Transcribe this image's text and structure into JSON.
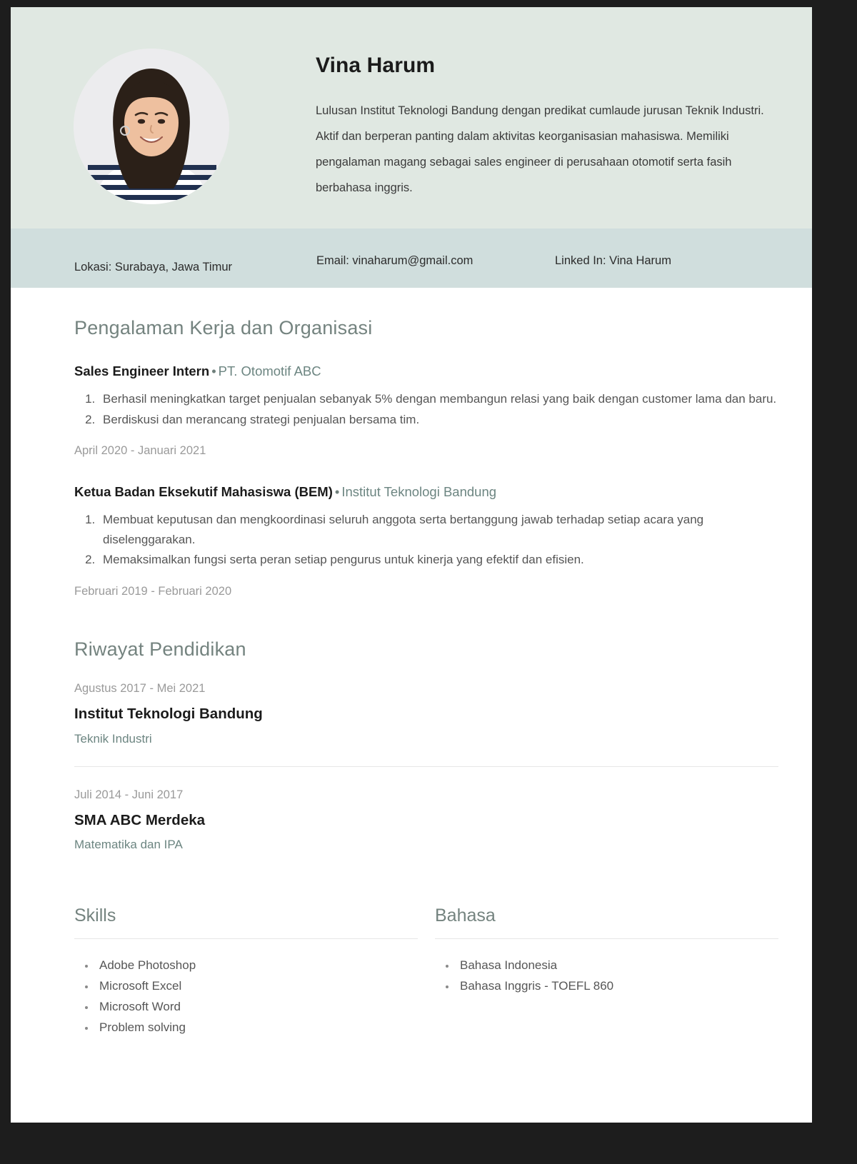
{
  "theme": {
    "header_bg": "#e0e8e2",
    "contact_bg": "#d0dedd",
    "page_bg": "#ffffff",
    "frame_bg": "#1d1d1d",
    "accent_heading": "#74837f",
    "accent_org": "#6c8581",
    "muted_text": "#9a9a9a",
    "body_text": "#565656"
  },
  "header": {
    "name": "Vina Harum",
    "summary": "Lulusan Institut Teknologi Bandung dengan predikat cumlaude jurusan Teknik Industri. Aktif dan berperan panting dalam aktivitas keorganisasian mahasiswa. Memiliki pengalaman magang sebagai sales engineer di perusahaan otomotif serta fasih berbahasa inggris.",
    "photo_alt": "Foto profil Vina Harum"
  },
  "contact": {
    "location": "Lokasi: Surabaya, Jawa Timur",
    "email": "Email: vinaharum@gmail.com",
    "linkedin": "Linked In: Vina Harum"
  },
  "experience": {
    "section_title": "Pengalaman Kerja dan Organisasi",
    "separator": "•",
    "entries": [
      {
        "title": "Sales Engineer Intern",
        "org": "PT. Otomotif ABC",
        "bullets": [
          "Berhasil meningkatkan target penjualan sebanyak 5% dengan membangun relasi yang baik dengan customer lama dan baru.",
          "Berdiskusi dan merancang strategi penjualan bersama tim."
        ],
        "date": "April 2020 - Januari 2021"
      },
      {
        "title": "Ketua Badan Eksekutif Mahasiswa (BEM)",
        "org": "Institut Teknologi Bandung",
        "bullets": [
          "Membuat keputusan dan mengkoordinasi seluruh anggota serta bertanggung jawab terhadap setiap acara yang diselenggarakan.",
          "Memaksimalkan fungsi serta peran setiap pengurus untuk kinerja yang efektif dan efisien."
        ],
        "date": "Februari 2019 - Februari 2020"
      }
    ]
  },
  "education": {
    "section_title": "Riwayat Pendidikan",
    "entries": [
      {
        "date": "Agustus 2017  - Mei 2021",
        "school": "Institut Teknologi Bandung",
        "major": "Teknik Industri"
      },
      {
        "date": "Juli 2014 - Juni 2017",
        "school": "SMA ABC Merdeka",
        "major": "Matematika dan IPA"
      }
    ]
  },
  "skills": {
    "title": "Skills",
    "items": [
      "Adobe Photoshop",
      "Microsoft Excel",
      "Microsoft Word",
      "Problem solving"
    ]
  },
  "languages": {
    "title": "Bahasa",
    "items": [
      "Bahasa Indonesia",
      "Bahasa Inggris - TOEFL 860"
    ]
  }
}
